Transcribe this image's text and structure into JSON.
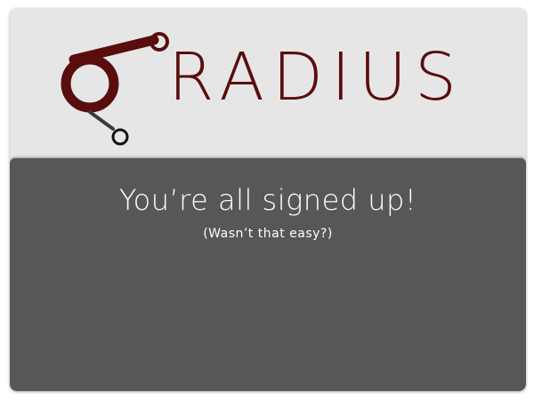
{
  "brand": {
    "name": "RADIUS",
    "logo_icon": "radius-logo-icon",
    "brand_color": "#5a0d0d"
  },
  "confirmation": {
    "headline": "You’re all signed up!",
    "subline": "(Wasn’t that easy?)"
  },
  "colors": {
    "header_background": "#e6e6e6",
    "panel_background": "#575757",
    "text_light": "#ffffff"
  }
}
